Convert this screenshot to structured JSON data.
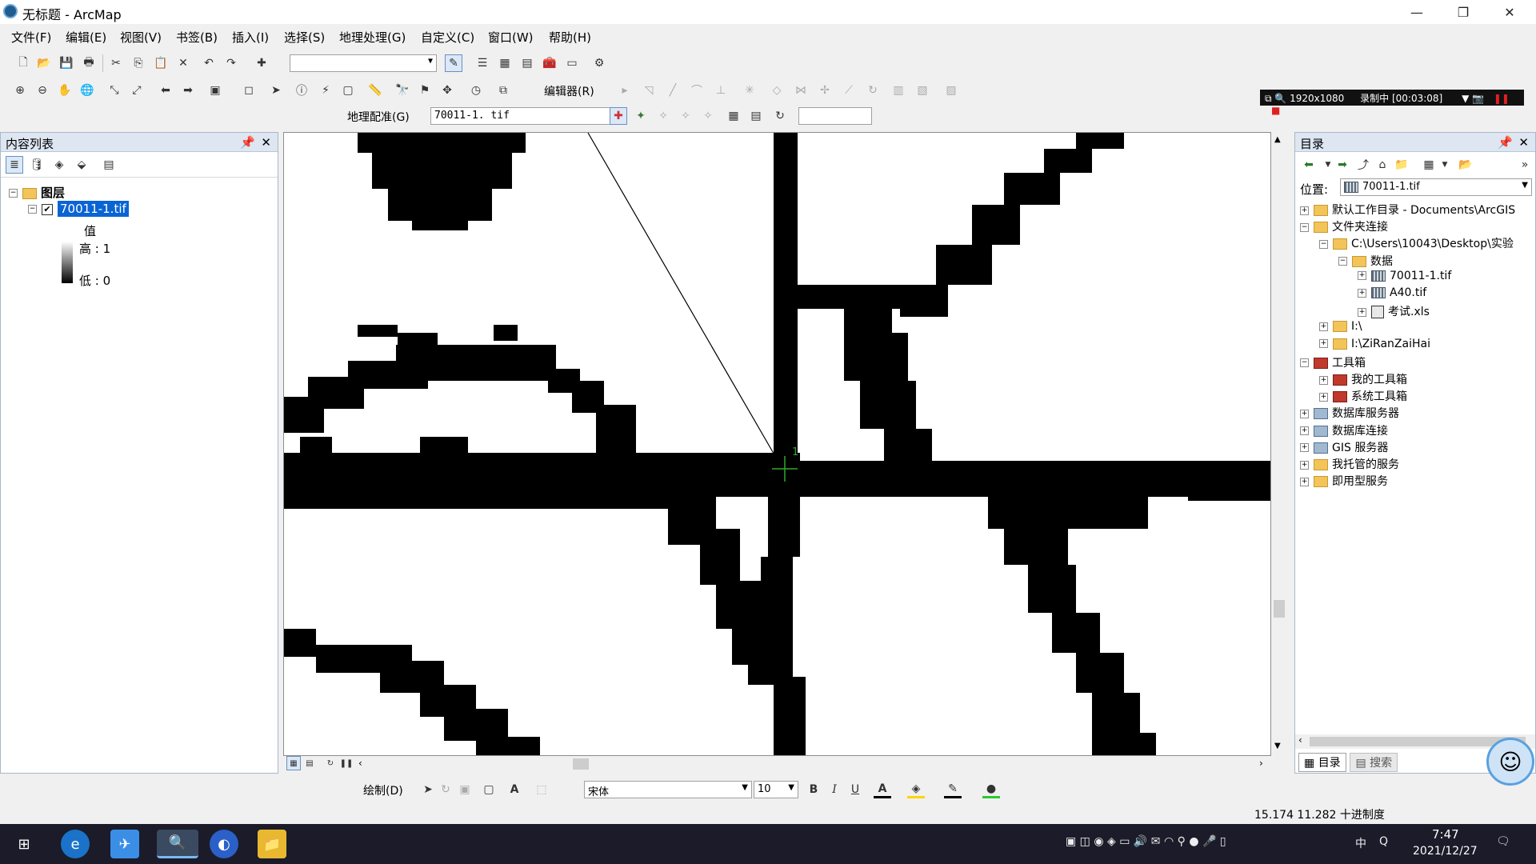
{
  "window": {
    "title": "无标题 - ArcMap",
    "minimize": "—",
    "restore": "❐",
    "close": "✕"
  },
  "menu": [
    "文件(F)",
    "编辑(E)",
    "视图(V)",
    "书签(B)",
    "插入(I)",
    "选择(S)",
    "地理处理(G)",
    "自定义(C)",
    "窗口(W)",
    "帮助(H)"
  ],
  "toolbar": {
    "editor_label": "编辑器(R)",
    "georef_label": "地理配准(G)",
    "georef_layer": "70011-1. tif",
    "scale_value": ""
  },
  "recorder": {
    "resolution": "1920x1080",
    "status": "录制中 [00:03:08]"
  },
  "toc": {
    "title": "内容列表",
    "layers_group": "图层",
    "layer_name": "70011-1.tif",
    "layer_checked": true,
    "legend_title": "值",
    "legend_high": "高 : 1",
    "legend_low": "低 : 0"
  },
  "map": {
    "cursor_label": "1"
  },
  "catalog": {
    "title": "目录",
    "location_label": "位置:",
    "location_value": "70011-1.tif",
    "tree": [
      {
        "label": "默认工作目录 - Documents\\ArcGIS",
        "icon": "folder-home-icon",
        "level": 0,
        "exp": "+"
      },
      {
        "label": "文件夹连接",
        "icon": "folder-connection-icon",
        "level": 0,
        "exp": "−"
      },
      {
        "label": "C:\\Users\\10043\\Desktop\\实验",
        "icon": "folder-icon",
        "level": 1,
        "exp": "−"
      },
      {
        "label": "数据",
        "icon": "folder-icon",
        "level": 2,
        "exp": "−"
      },
      {
        "label": "70011-1.tif",
        "icon": "raster-icon",
        "level": 3,
        "exp": "+"
      },
      {
        "label": "A40.tif",
        "icon": "raster-icon",
        "level": 3,
        "exp": "+"
      },
      {
        "label": "考试.xls",
        "icon": "spreadsheet-icon",
        "level": 3,
        "exp": "+"
      },
      {
        "label": "I:\\",
        "icon": "folder-icon",
        "level": 1,
        "exp": "+"
      },
      {
        "label": "I:\\ZiRanZaiHai",
        "icon": "folder-icon",
        "level": 1,
        "exp": "+"
      },
      {
        "label": "工具箱",
        "icon": "toolbox-icon",
        "level": 0,
        "exp": "−"
      },
      {
        "label": "我的工具箱",
        "icon": "toolbox-icon",
        "level": 1,
        "exp": "+"
      },
      {
        "label": "系统工具箱",
        "icon": "toolbox-icon",
        "level": 1,
        "exp": "+"
      },
      {
        "label": "数据库服务器",
        "icon": "db-server-icon",
        "level": 0,
        "exp": "+"
      },
      {
        "label": "数据库连接",
        "icon": "db-connection-icon",
        "level": 0,
        "exp": "+"
      },
      {
        "label": "GIS 服务器",
        "icon": "gis-server-icon",
        "level": 0,
        "exp": "+"
      },
      {
        "label": "我托管的服务",
        "icon": "hosted-services-icon",
        "level": 0,
        "exp": "+"
      },
      {
        "label": "即用型服务",
        "icon": "ready-services-icon",
        "level": 0,
        "exp": "+"
      }
    ],
    "tab_catalog": "目录",
    "tab_search": "搜索"
  },
  "drawbar": {
    "draw_label": "绘制(D)",
    "font_name": "宋体",
    "font_size": "10",
    "bold": "B",
    "italic": "I",
    "underline": "U"
  },
  "status": {
    "coords": "15.174  11.282 十进制度"
  },
  "taskbar": {
    "time": "7:47",
    "date": "2021/12/27",
    "ime": "中"
  }
}
